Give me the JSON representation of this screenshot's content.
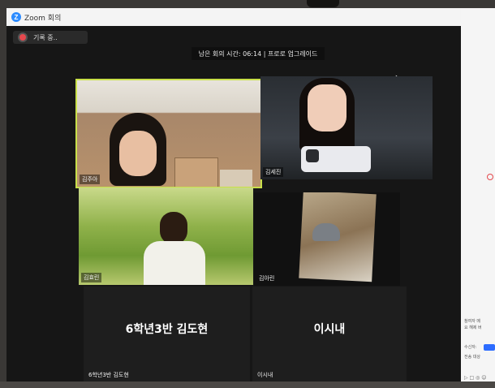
{
  "window": {
    "title": "Zoom 회의"
  },
  "recording": {
    "label": "기록 중.."
  },
  "timer": {
    "text": "남은 회의 시간: 06:14 | 프로로 업그레이드"
  },
  "participants": [
    {
      "name": "김주아"
    },
    {
      "name": "김세진"
    },
    {
      "name": "김효린"
    },
    {
      "name": "김아린"
    },
    {
      "name": "6학년3반 김도현",
      "display_name": "6학년3반 김도현"
    },
    {
      "name": "이시내",
      "display_name": "이시내"
    }
  ],
  "colors": {
    "active_speaker_border": "#c9e04a",
    "record_dot": "#e5484d",
    "zoom_blue": "#2d8cff"
  },
  "side_panel": {
    "line1": "참여자 메",
    "line2": "요 해제 버",
    "line3": "수신자:",
    "line4": "전송 대상"
  }
}
